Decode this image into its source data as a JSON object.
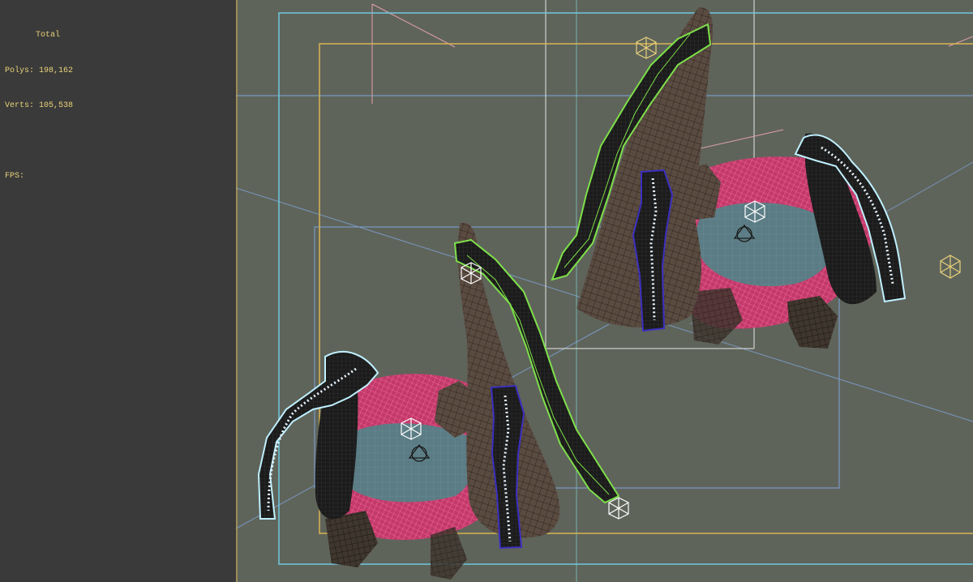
{
  "stats": {
    "header": "Total",
    "polys_label": "Polys:",
    "polys_value": "198,162",
    "verts_label": "Verts:",
    "verts_value": "105,538",
    "fps_label": "FPS:"
  },
  "colors": {
    "viewport_bg": "#5f645b",
    "panel_bg": "#3a3a3a",
    "stats_text": "#e8d27a",
    "safe_frame_outer": "#6ec8e0",
    "safe_frame_action": "#d8b452",
    "grid_line": "#7fa4d8",
    "selection_green": "#7ee04a",
    "selection_cyan": "#bff0ff",
    "waterfall_blue": "#3b2fbf",
    "foliage_pink": "#e0407a",
    "water": "#5e7f86",
    "rock": "#4a4038"
  },
  "icons": [
    "camera-gizmo-icon",
    "light-helper-icon",
    "target-helper-icon"
  ]
}
